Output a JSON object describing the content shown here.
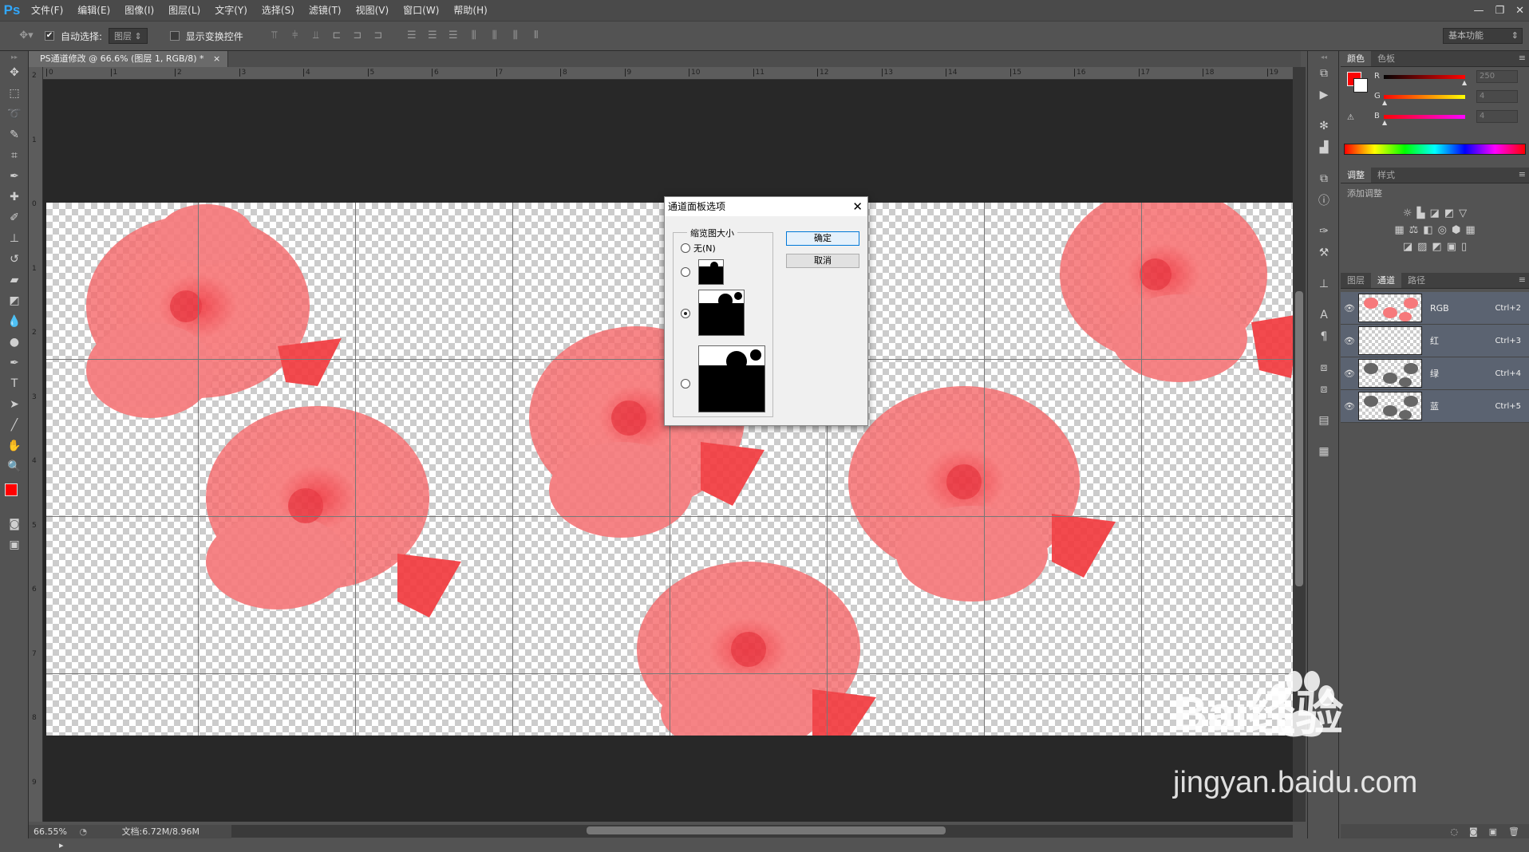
{
  "app": {
    "logo": "Ps"
  },
  "menu": [
    "文件(F)",
    "编辑(E)",
    "图像(I)",
    "图层(L)",
    "文字(Y)",
    "选择(S)",
    "滤镜(T)",
    "视图(V)",
    "窗口(W)",
    "帮助(H)"
  ],
  "window_controls": {
    "minimize": "—",
    "restore": "❐",
    "close": "✕"
  },
  "options": {
    "auto_select_label": "自动选择:",
    "auto_select_checked": "✔",
    "auto_select_value": "图层",
    "show_transform_label": "显示变换控件",
    "workspace": "基本功能"
  },
  "document": {
    "tab_title": "PS通道修改 @ 66.6% (图层 1, RGB/8) *",
    "tab_close": "×",
    "zoom": "66.55%",
    "doc_size": "文档:6.72M/8.96M"
  },
  "rulers": {
    "h_ticks": [
      "0",
      "1",
      "2",
      "3",
      "4",
      "5",
      "6",
      "7",
      "8",
      "9",
      "10",
      "11",
      "12",
      "13",
      "14",
      "15",
      "16",
      "17",
      "18",
      "19"
    ],
    "v_ticks": [
      "2",
      "1",
      "0",
      "1",
      "2",
      "3",
      "4",
      "5",
      "6",
      "7",
      "8",
      "9"
    ]
  },
  "color_panel": {
    "tabs": [
      "颜色",
      "色板"
    ],
    "channels": [
      {
        "label": "R",
        "value": "250"
      },
      {
        "label": "G",
        "value": "4"
      },
      {
        "label": "B",
        "value": "4"
      }
    ],
    "foreground": "#fa0404"
  },
  "adjust_panel": {
    "tabs": [
      "调整",
      "样式"
    ],
    "add_label": "添加调整"
  },
  "channels_panel": {
    "tabs": [
      "图层",
      "通道",
      "路径"
    ],
    "rows": [
      {
        "name": "RGB",
        "key": "Ctrl+2"
      },
      {
        "name": "红",
        "key": "Ctrl+3"
      },
      {
        "name": "绿",
        "key": "Ctrl+4"
      },
      {
        "name": "蓝",
        "key": "Ctrl+5"
      }
    ]
  },
  "dialog": {
    "title": "通道面板选项",
    "close": "✕",
    "group_label": "缩览图大小",
    "none_option": "无(N)",
    "ok": "确定",
    "cancel": "取消",
    "selected_index": 2
  },
  "watermark": {
    "brand": "Bai经验",
    "url": "jingyan.baidu.com"
  },
  "colors": {
    "flower": "#f4696a",
    "accent": "#31a8ff",
    "selection": "#5b6371"
  }
}
